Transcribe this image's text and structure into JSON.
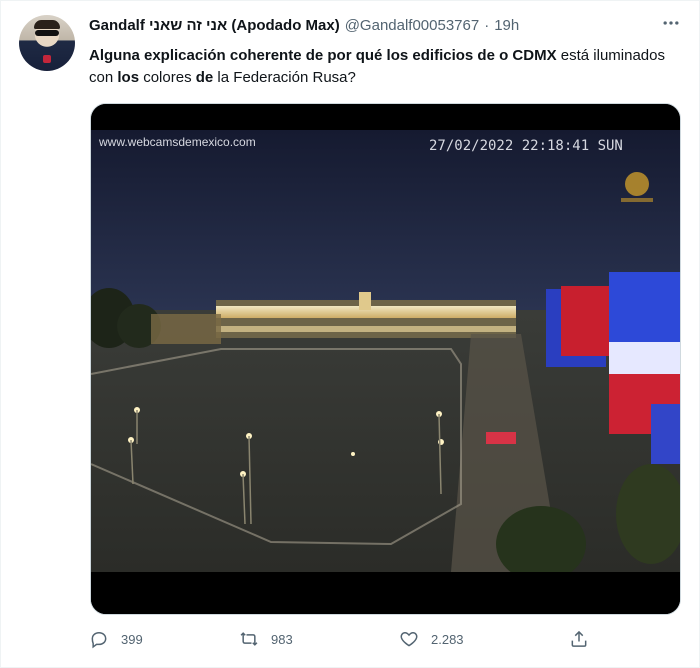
{
  "tweet": {
    "display_name": "Gandalf אני זה שאני (Apodado Max)",
    "handle": "@Gandalf00053767",
    "separator": "·",
    "time": "19h",
    "more_icon": "more-horizontal-icon",
    "text_parts": [
      {
        "t": "Alguna explicación coherente de por qué los edificios de o CDMX",
        "bold": true
      },
      {
        "t": " está iluminados con ",
        "bold": false
      },
      {
        "t": "los",
        "bold": true
      },
      {
        "t": " colores ",
        "bold": false
      },
      {
        "t": "de",
        "bold": true
      },
      {
        "t": " la Federación Rusa?",
        "bold": false
      }
    ],
    "media": {
      "watermark": "www.webcamsdemexico.com",
      "timestamp": "27/02/2022  22:18:41  SUN"
    },
    "actions": {
      "reply_count": "399",
      "retweet_count": "983",
      "like_count": "2.283",
      "reply_icon": "reply-icon",
      "retweet_icon": "retweet-icon",
      "like_icon": "heart-icon",
      "share_icon": "share-icon"
    }
  },
  "colors": {
    "text_primary": "#0f1419",
    "text_secondary": "#536471",
    "border": "#cfd9de"
  }
}
